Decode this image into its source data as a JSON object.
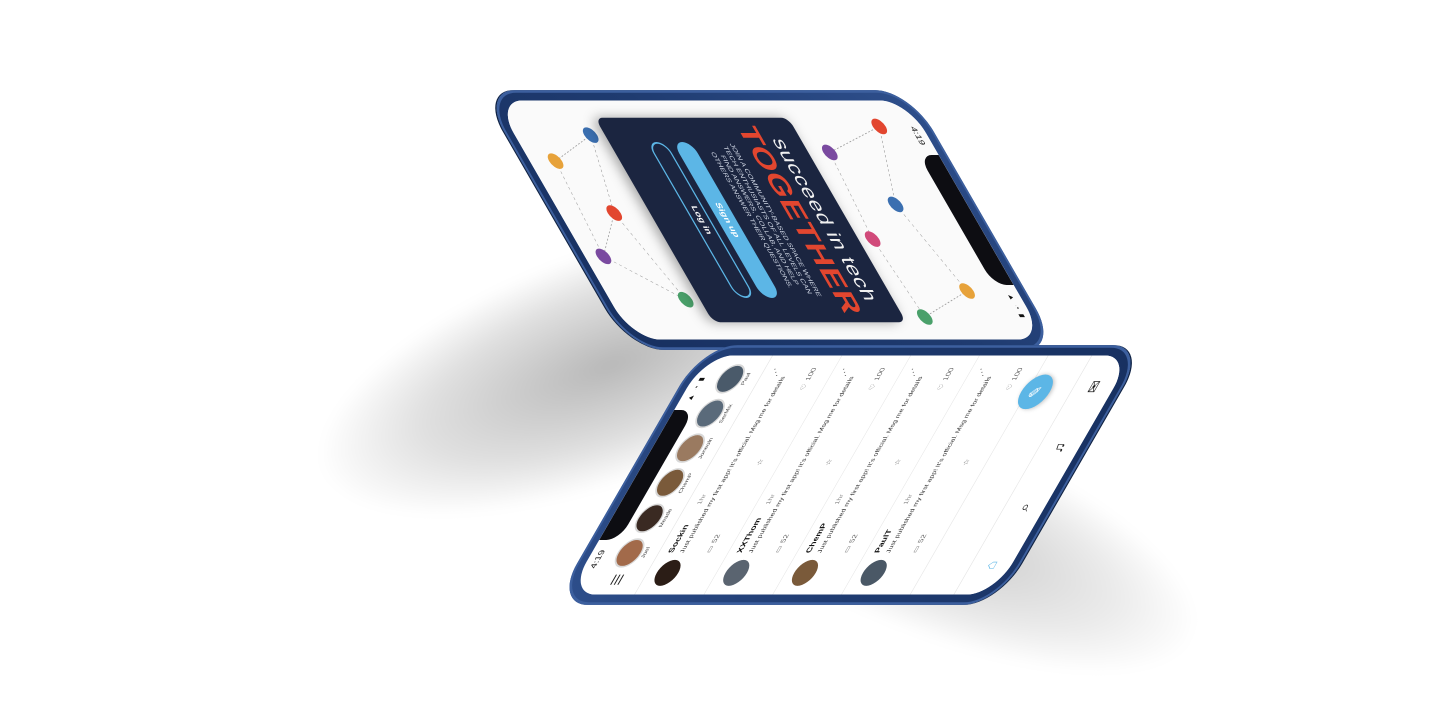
{
  "signup_phone": {
    "status_time": "4:19",
    "status_icons": "▲ ◔ ▮",
    "tagline": "succeed in tech",
    "emphasis": "TOGETHER",
    "description": "JOIN A COMMUNITY-BASED SPACE WHERE TECH ENTHUSIASTS OF ALL LEVELS CAN FIND ANSWERS, COLLAB, AND HELP OTHERS ANSWER THEIR QUESTIONS.",
    "signup_label": "Sign up",
    "login_label": "Log in"
  },
  "feed_phone": {
    "status_time": "4:19",
    "status_icons": "▲ ◔ ▮",
    "stories": [
      {
        "name": "Joel",
        "color": "#a26a4a"
      },
      {
        "name": "Meade",
        "color": "#3a2a22"
      },
      {
        "name": "ChemP",
        "color": "#7a5a3a"
      },
      {
        "name": "Joneoln",
        "color": "#9a7a60"
      },
      {
        "name": "SerMix",
        "color": "#5a6a7a"
      },
      {
        "name": "Paul",
        "color": "#4a5a6a"
      },
      {
        "name": "Ryland",
        "color": "#8a6a4a"
      }
    ],
    "posts": [
      {
        "name": "Sockin",
        "time": "1hr",
        "text": "Just published my first app! It's official. Msg me for details",
        "comments": "52",
        "likes": "100",
        "avatar_color": "#2b1d16"
      },
      {
        "name": "XXThom",
        "time": "1hr",
        "text": "Just published my first app! It's official. Msg me for details",
        "comments": "52",
        "likes": "100",
        "avatar_color": "#5a6470"
      },
      {
        "name": "ChemP",
        "time": "1hr",
        "text": "Just published my first app! It's official. Msg me for details",
        "comments": "52",
        "likes": "100",
        "avatar_color": "#7a5a3a"
      },
      {
        "name": "PaulT",
        "time": "1hr",
        "text": "Just published my first app! It's official. Msg me for details",
        "comments": "52",
        "likes": "100",
        "avatar_color": "#4a5866"
      }
    ],
    "fab_icon": "compose-icon",
    "tabs": [
      "home-icon",
      "search-icon",
      "bell-icon",
      "mail-icon"
    ],
    "accent": "#5cb6e6"
  }
}
